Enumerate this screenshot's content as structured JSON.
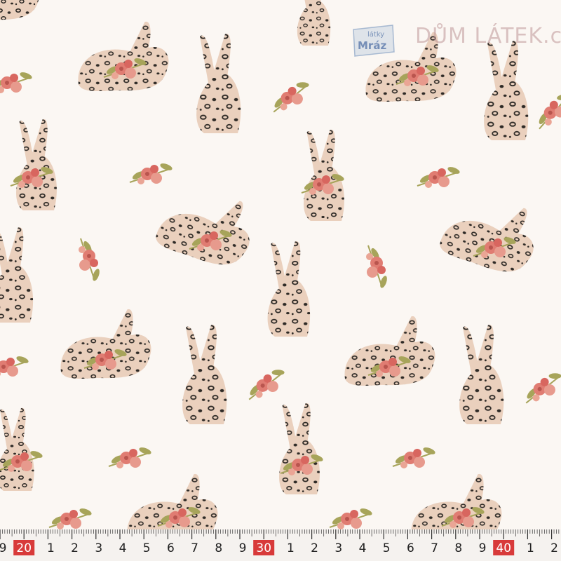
{
  "watermark": {
    "badge_top": "látky",
    "badge_main": "Mráz",
    "site": "DŮM LÁTEK.cz"
  },
  "ruler": {
    "digits": [
      "9",
      "20",
      "1",
      "2",
      "3",
      "4",
      "5",
      "6",
      "7",
      "8",
      "9",
      "30",
      "1",
      "2",
      "3",
      "4",
      "5",
      "6",
      "7",
      "8",
      "9",
      "40",
      "1",
      "2"
    ],
    "highlighted": [
      "20",
      "30",
      "40"
    ],
    "highlight_color": "#d83a3a",
    "number_color": "#222222",
    "background_color": "#f5f2ef",
    "minor_marks_per_unit": 10
  },
  "pattern": {
    "background_color": "#fbf7f3",
    "rabbit_fill": "#ead0bd",
    "spot_color": "#2e2a26",
    "flower_color": "#e07c72",
    "leaf_color": "#a7a45a",
    "motifs": [
      "leopard-rabbit-sitting",
      "leopard-rabbit-crouching",
      "flower-bouquet"
    ]
  }
}
